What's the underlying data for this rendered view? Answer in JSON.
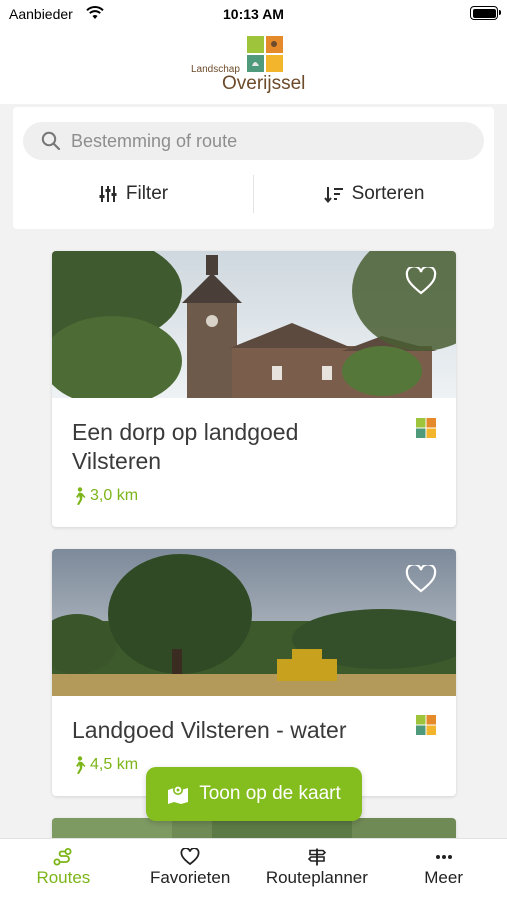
{
  "status_bar": {
    "carrier": "Aanbieder",
    "time": "10:13 AM",
    "battery_level": 1.0
  },
  "header": {
    "logo_small": "Landschap",
    "logo_big": "Overijssel"
  },
  "search": {
    "placeholder": "Bestemming of route"
  },
  "toolbar": {
    "filter_label": "Filter",
    "sort_label": "Sorteren"
  },
  "routes": [
    {
      "title": "Een dorp op landgoed Vilsteren",
      "distance": "3,0 km"
    },
    {
      "title": "Landgoed Vilsteren - water",
      "distance": "4,5 km"
    }
  ],
  "map_button": {
    "label": "Toon op de kaart"
  },
  "tabs": [
    {
      "label": "Routes",
      "icon": "routes-icon",
      "active": true
    },
    {
      "label": "Favorieten",
      "icon": "heart-icon",
      "active": false
    },
    {
      "label": "Routeplanner",
      "icon": "signpost-icon",
      "active": false
    },
    {
      "label": "Meer",
      "icon": "more-icon",
      "active": false
    }
  ],
  "colors": {
    "accent": "#84bd1e",
    "accent_text": "#7cb518",
    "logo_brown": "#6d4b2a"
  }
}
